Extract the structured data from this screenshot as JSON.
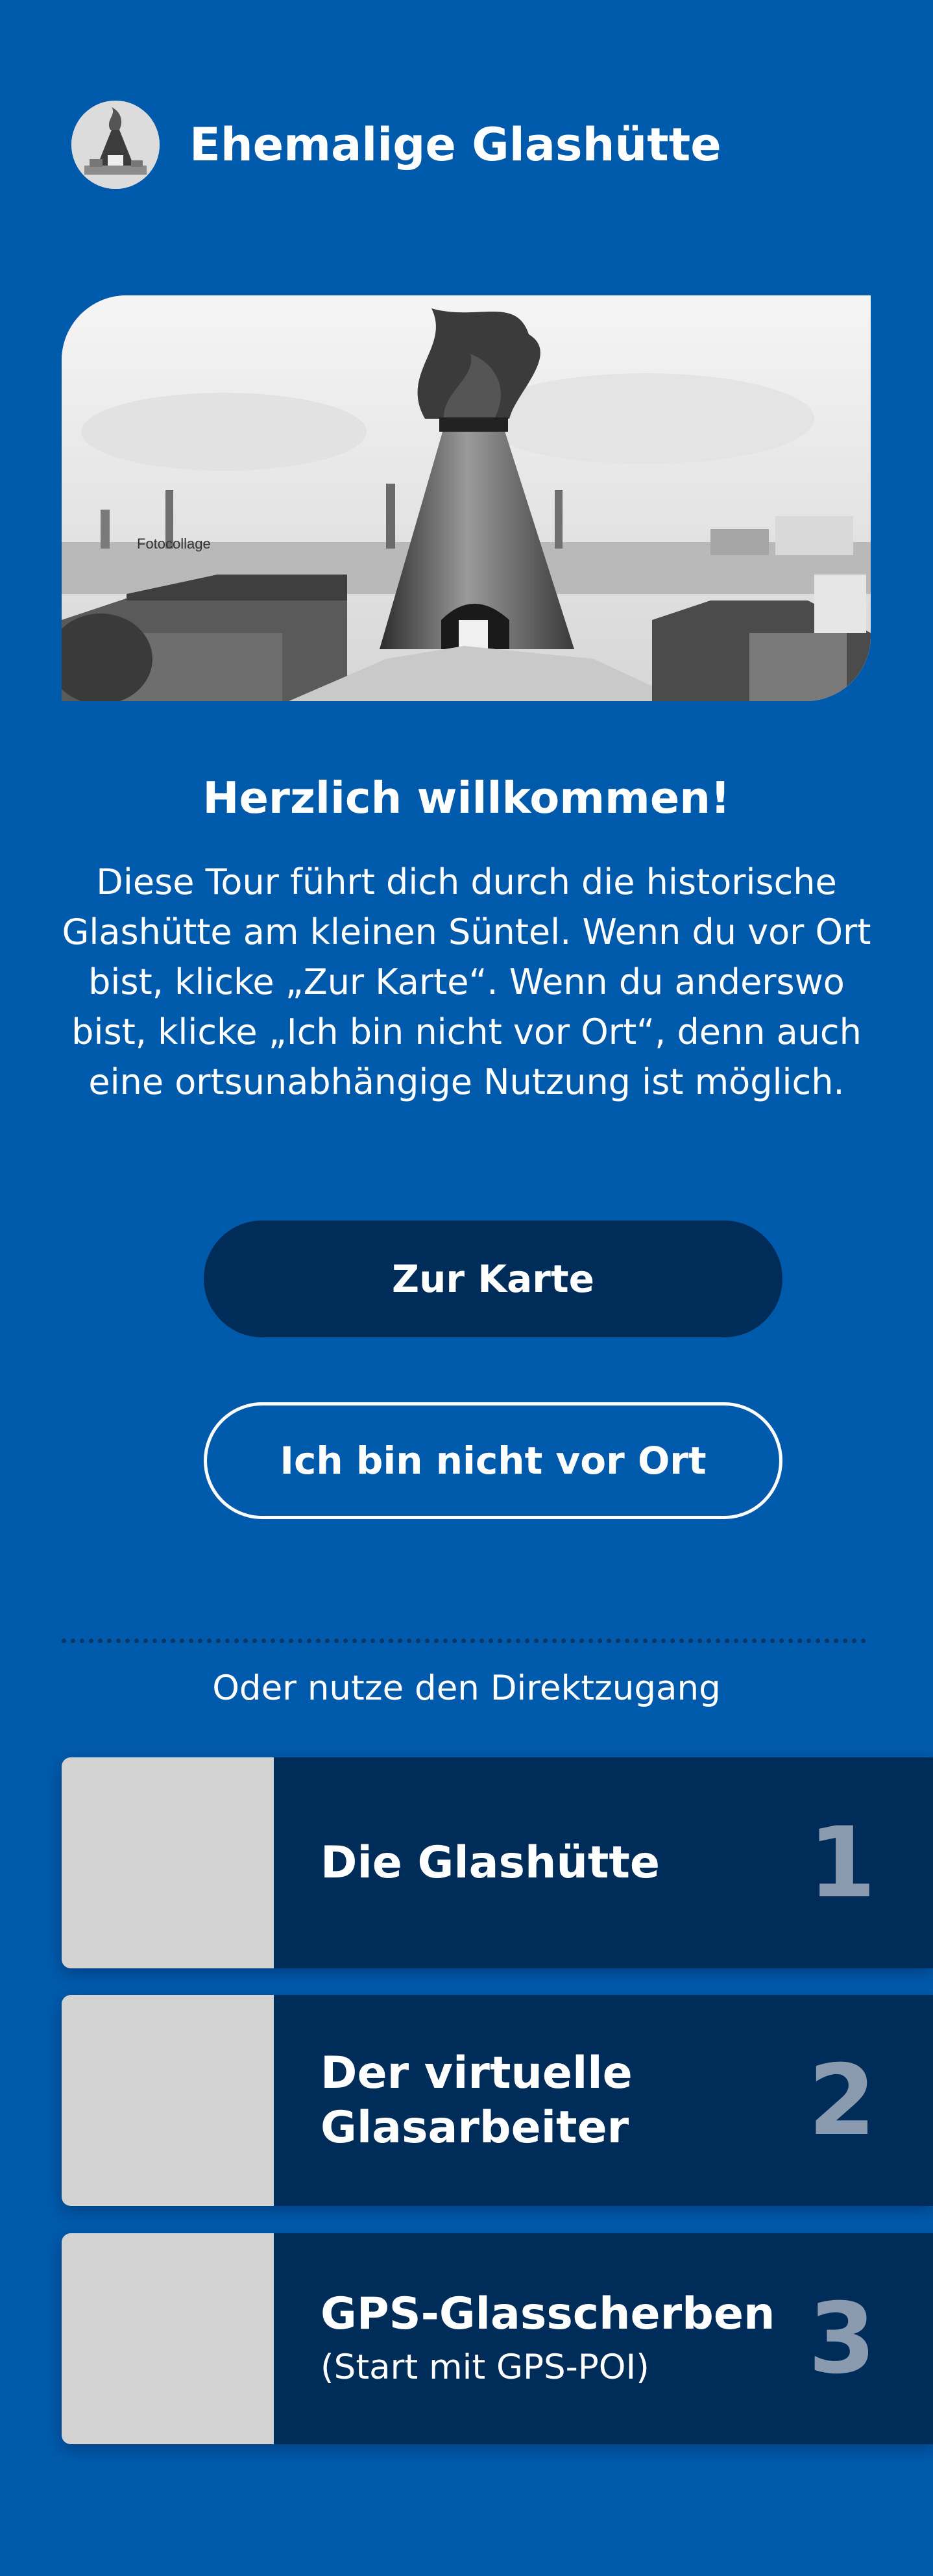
{
  "header": {
    "title": "Ehemalige Glashütte",
    "logo_icon": "glass-furnace-icon"
  },
  "hero": {
    "caption": "Fotocollage"
  },
  "welcome": {
    "title": "Herzlich willkommen!",
    "text": "Diese Tour führt dich durch die historische Glashütte am kleinen Süntel. Wenn du vor Ort bist, klicke „Zur Karte“. Wenn du anderswo bist, klicke „Ich bin nicht vor Ort“, denn auch eine ortsunabhängige Nutzung ist möglich."
  },
  "buttons": {
    "map": "Zur Karte",
    "not_here": "Ich bin nicht vor Ort"
  },
  "direct_access": {
    "label": "Oder nutze den Direktzugang",
    "items": [
      {
        "title": "Die Glashütte",
        "subtitle": "",
        "number": "1"
      },
      {
        "title": "Der virtuelle Glasarbeiter",
        "subtitle": "",
        "number": "2"
      },
      {
        "title": "GPS-Glasscherben",
        "subtitle": "(Start mit GPS-POI)",
        "number": "3"
      }
    ]
  },
  "colors": {
    "background": "#005AAB",
    "dark_blue": "#002C5A",
    "thumb_gray": "#D3D3D3",
    "number_gray": "#8A9BB0"
  }
}
